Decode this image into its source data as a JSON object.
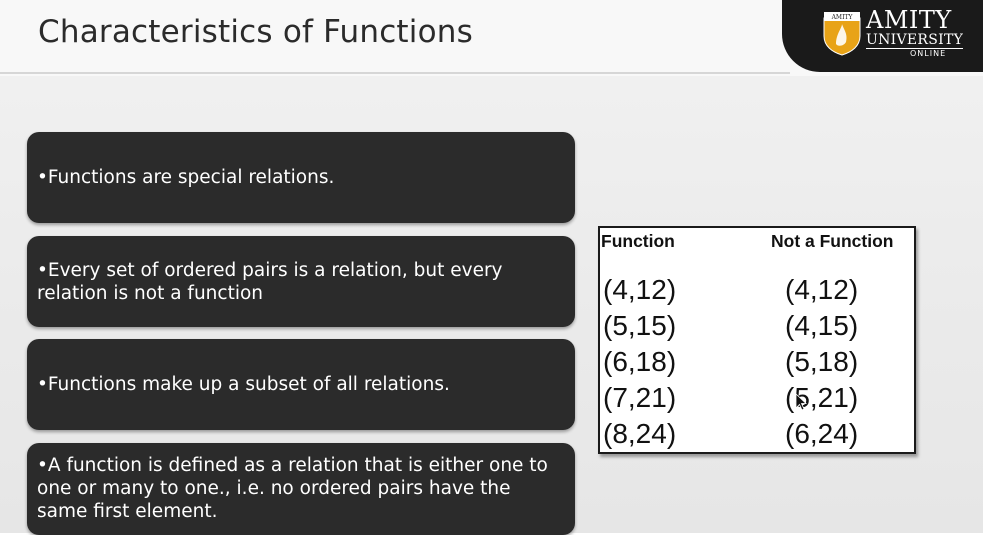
{
  "slide": {
    "title": "Characteristics of Functions"
  },
  "logo": {
    "crest_text": "AMITY",
    "name": "AMITY",
    "university": "UNIVERSITY",
    "online": "ONLINE",
    "colors": {
      "panel": "#1a1a1a",
      "crest": "#e8a317"
    }
  },
  "cards": [
    {
      "text": "•Functions are special relations."
    },
    {
      "text": "•Every set of ordered pairs is a relation, but every relation is not a function"
    },
    {
      "text": "•Functions make up a subset of all relations."
    },
    {
      "text": "•A function is defined as a relation that is either one to one or many to one., i.e. no ordered pairs have the same first element."
    }
  ],
  "table": {
    "headers": [
      "Function",
      "Not a Function"
    ],
    "function_pairs": [
      "(4,12)",
      "(5,15)",
      "(6,18)",
      "(7,21)",
      "(8,24)"
    ],
    "not_function_pairs": [
      "(4,12)",
      "(4,15)",
      "(5,18)",
      "(5,21)",
      "(6,24)"
    ]
  }
}
